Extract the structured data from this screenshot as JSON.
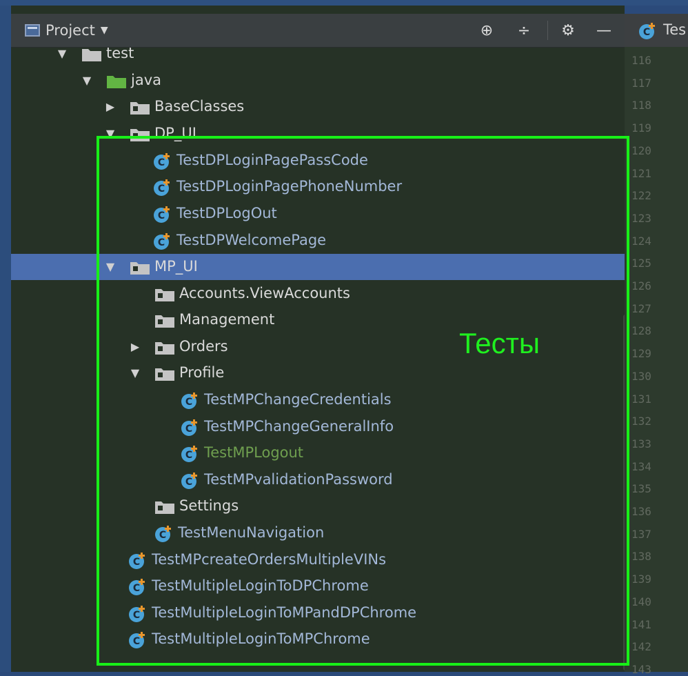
{
  "panel": {
    "title": "Project",
    "caret": "▼",
    "buttons": {
      "locate": "⊕",
      "collapse": "÷",
      "settings": "⚙",
      "hide": "—"
    }
  },
  "editor": {
    "tab_label": "Tes",
    "line_numbers": [
      "116",
      "117",
      "118",
      "119",
      "120",
      "121",
      "122",
      "123",
      "124",
      "125",
      "126",
      "127",
      "128",
      "129",
      "130",
      "131",
      "132",
      "133",
      "134",
      "135",
      "136",
      "137",
      "138",
      "139",
      "140",
      "141",
      "142",
      "143"
    ]
  },
  "tree": {
    "items": [
      {
        "label": "test",
        "kind": "folder-gray",
        "expanded": true
      },
      {
        "label": "java",
        "kind": "folder-green",
        "expanded": true
      },
      {
        "label": "BaseClasses",
        "kind": "package",
        "expanded": false
      },
      {
        "label": "DP_UI",
        "kind": "package",
        "expanded": true
      },
      {
        "label": "TestDPLoginPagePassCode",
        "kind": "test-class"
      },
      {
        "label": "TestDPLoginPagePhoneNumber",
        "kind": "test-class"
      },
      {
        "label": "TestDPLogOut",
        "kind": "test-class"
      },
      {
        "label": "TestDPWelcomePage",
        "kind": "test-class"
      },
      {
        "label": "MP_UI",
        "kind": "package",
        "expanded": true,
        "selected": true
      },
      {
        "label": "Accounts.ViewAccounts",
        "kind": "package"
      },
      {
        "label": "Management",
        "kind": "package"
      },
      {
        "label": "Orders",
        "kind": "package",
        "expanded": false
      },
      {
        "label": "Profile",
        "kind": "package",
        "expanded": true
      },
      {
        "label": "TestMPChangeCredentials",
        "kind": "test-class"
      },
      {
        "label": "TestMPChangeGeneralInfo",
        "kind": "test-class"
      },
      {
        "label": "TestMPLogout",
        "kind": "test-class",
        "modified": true
      },
      {
        "label": "TestMPvalidationPassword",
        "kind": "test-class"
      },
      {
        "label": "Settings",
        "kind": "package"
      },
      {
        "label": "TestMenuNavigation",
        "kind": "test-class"
      },
      {
        "label": "TestMPcreateOrdersMultipleVINs",
        "kind": "test-class"
      },
      {
        "label": "TestMultipleLoginToDPChrome",
        "kind": "test-class"
      },
      {
        "label": "TestMultipleLoginToMPandDPChrome",
        "kind": "test-class"
      },
      {
        "label": "TestMultipleLoginToMPChrome",
        "kind": "test-class"
      }
    ]
  },
  "annotation": {
    "text": "Тесты",
    "color": "#18ef18"
  },
  "colors": {
    "selection": "#4b6eaf",
    "test_label": "#a3b8d8",
    "modified_label": "#6f9f4f",
    "class_icon": "#4aa3d9",
    "panel_bg": "#263226"
  }
}
